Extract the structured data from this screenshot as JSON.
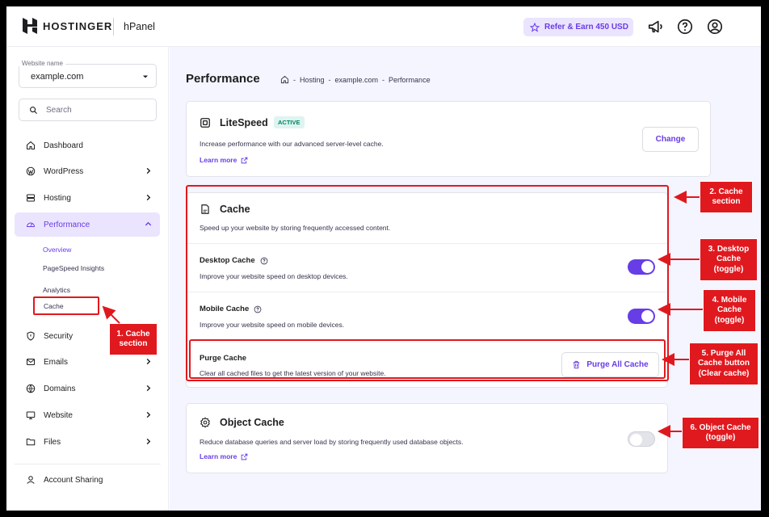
{
  "header": {
    "brand": "HOSTINGER",
    "panel": "hPanel",
    "refer_label": "Refer & Earn 450 USD"
  },
  "sidebar": {
    "website_label": "Website name",
    "website_value": "example.com",
    "search_placeholder": "Search",
    "nav": {
      "dashboard": "Dashboard",
      "wordpress": "WordPress",
      "hosting": "Hosting",
      "performance": "Performance",
      "security": "Security",
      "emails": "Emails",
      "domains": "Domains",
      "website": "Website",
      "files": "Files",
      "account_sharing": "Account Sharing"
    },
    "performance_sub": {
      "overview": "Overview",
      "pagespeed": "PageSpeed Insights",
      "analytics": "Analytics",
      "cache": "Cache"
    }
  },
  "main": {
    "title": "Performance",
    "breadcrumb": [
      "Hosting",
      "example.com",
      "Performance"
    ],
    "breadcrumb_sep": "-",
    "litespeed": {
      "title": "LiteSpeed",
      "badge": "ACTIVE",
      "desc": "Increase performance with our advanced server-level cache.",
      "learn_more": "Learn more",
      "change_label": "Change"
    },
    "cache": {
      "title": "Cache",
      "desc": "Speed up your website by storing frequently accessed content.",
      "desktop": {
        "title": "Desktop Cache",
        "desc": "Improve your website speed on desktop devices.",
        "enabled": true
      },
      "mobile": {
        "title": "Mobile Cache",
        "desc": "Improve your website speed on mobile devices.",
        "enabled": true
      },
      "purge": {
        "title": "Purge Cache",
        "desc": "Clear all cached files to get the latest version of your website.",
        "button_label": "Purge All Cache"
      }
    },
    "object_cache": {
      "title": "Object Cache",
      "desc": "Reduce database queries and server load by storing frequently used database objects.",
      "learn_more": "Learn more",
      "enabled": false
    }
  },
  "callouts": {
    "c1": "1. Cache\nsection",
    "c2": "2. Cache\nsection",
    "c3": "3. Desktop\nCache\n(toggle)",
    "c4": "4. Mobile\nCache\n(toggle)",
    "c5": "5. Purge All\nCache button\n(Clear cache)",
    "c6": "6. Object Cache\n(toggle)"
  },
  "colors": {
    "accent": "#673de6",
    "annotation": "#e0191f",
    "badge_bg": "#def4f0",
    "badge_text": "#008361"
  }
}
